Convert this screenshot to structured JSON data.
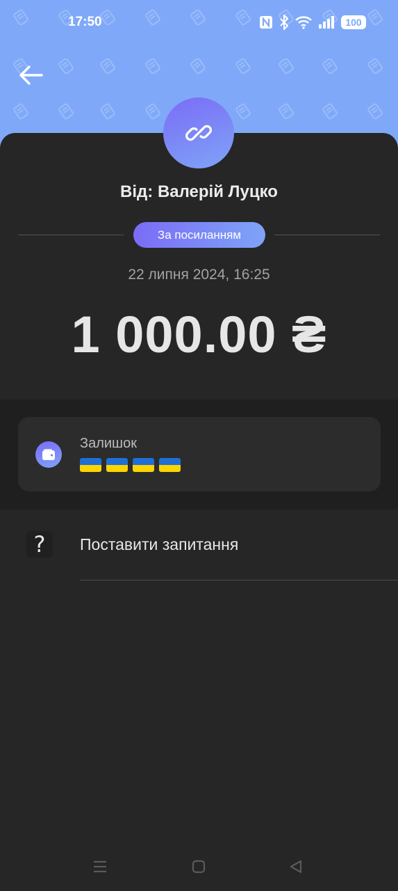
{
  "status_bar": {
    "time": "17:50",
    "battery": "100",
    "icons": [
      "nfc-icon",
      "bluetooth-icon",
      "wifi-icon",
      "signal-icon",
      "battery-icon"
    ]
  },
  "header": {
    "back_icon": "arrow-left-icon",
    "pattern_icon": "coin-stack-icon",
    "colors": {
      "header_bg": "#7fa9f8",
      "accent_start": "#7b6cf6",
      "accent_end": "#7ea4f7"
    }
  },
  "transaction": {
    "avatar_icon": "link-icon",
    "from": "Від: Валерій Луцко",
    "method": "За посиланням",
    "datetime": "22 липня 2024, 16:25",
    "amount": "1 000.00 ₴"
  },
  "balance": {
    "icon": "wallet-icon",
    "label": "Залишок",
    "value_flags": "🇺🇦🇺🇦🇺🇦🇺🇦"
  },
  "help": {
    "icon": "question-icon",
    "symbol": "?",
    "label": "Поставити запитання"
  },
  "nav": {
    "icons": [
      "menu-icon",
      "home-icon",
      "back-triangle-icon"
    ]
  }
}
